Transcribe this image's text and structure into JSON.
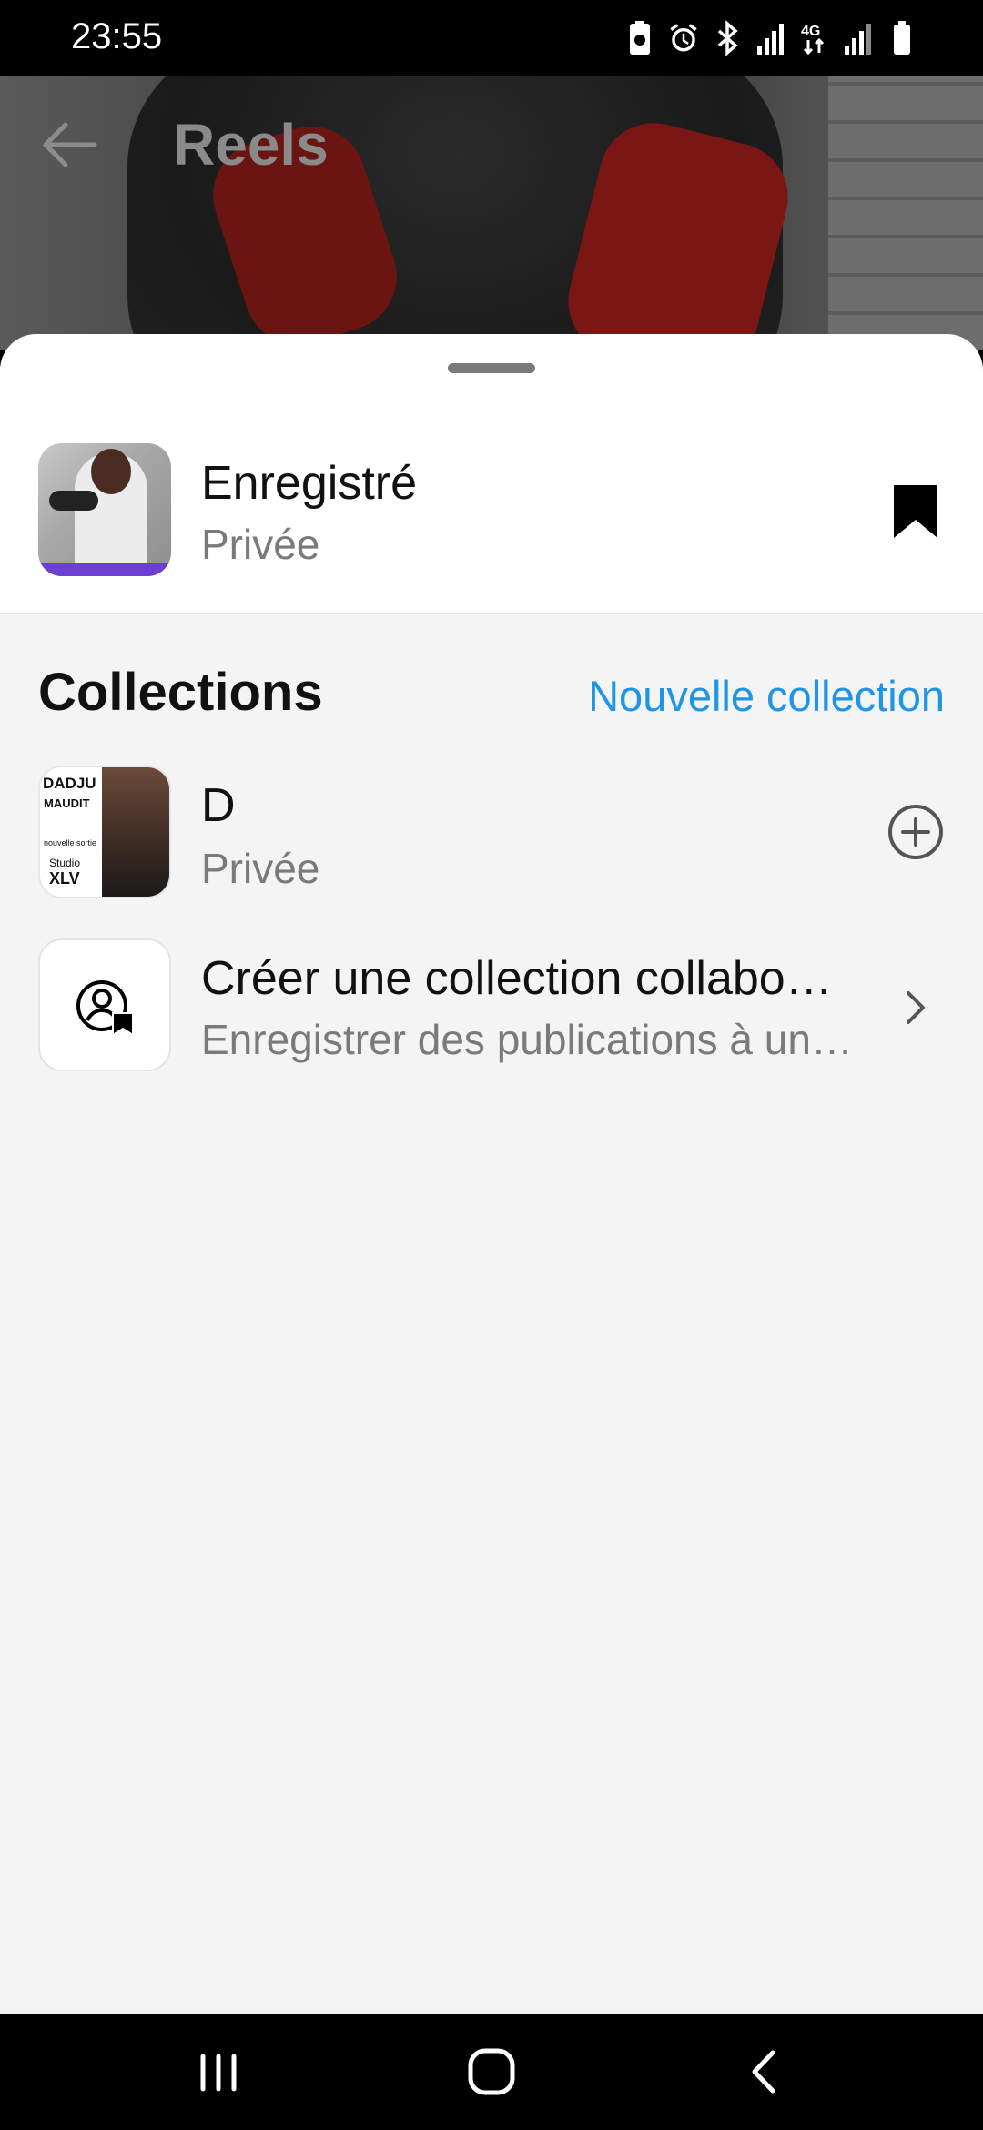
{
  "status_bar": {
    "time": "23:55",
    "icons": [
      "battery-saver-icon",
      "alarm-icon",
      "bluetooth-icon",
      "signal-icon",
      "4g-icon",
      "signal-icon-2",
      "battery-icon"
    ]
  },
  "header": {
    "title": "Reels",
    "back_icon": "arrow-left-icon"
  },
  "sheet": {
    "saved": {
      "title": "Enregistré",
      "subtitle": "Privée",
      "icon": "bookmark-filled-icon"
    },
    "collections_heading": "Collections",
    "new_collection_label": "Nouvelle collection",
    "collections": [
      {
        "title": "D",
        "subtitle": "Privée",
        "action_icon": "plus-circle-icon",
        "thumb_text": {
          "line1": "DADJU",
          "line2": "MAUDIT",
          "line3": "nouvelle sortie",
          "line4": "Studio",
          "line5": "XLV"
        }
      }
    ],
    "collab": {
      "title": "Créer une collection collabo…",
      "subtitle": "Enregistrer des publications à un…",
      "icon": "person-bookmark-icon",
      "action_icon": "chevron-right-icon"
    }
  },
  "nav_bar": {
    "buttons": [
      "recents-icon",
      "home-icon",
      "back-icon"
    ]
  }
}
